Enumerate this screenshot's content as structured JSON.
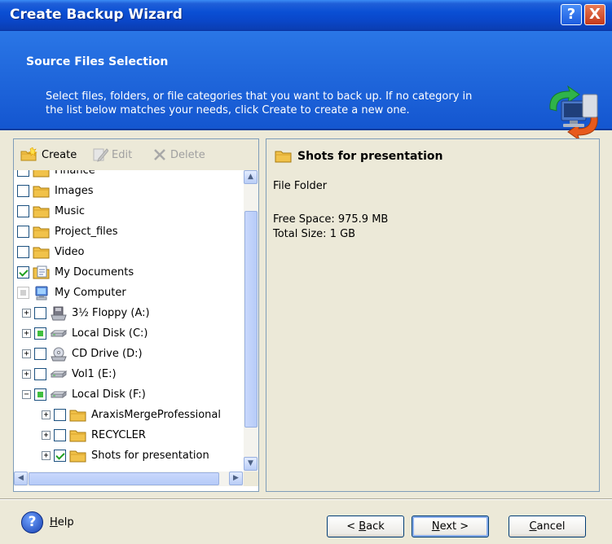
{
  "window": {
    "title": "Create Backup Wizard",
    "help_btn": "?",
    "close_btn": "X"
  },
  "header": {
    "title": "Source Files Selection",
    "description_line1": "Select files, folders, or file categories that you want to back up. If no category in",
    "description_line2": "the list below matches your needs, click Create to create a new one."
  },
  "toolbar": {
    "create": "Create",
    "edit": "Edit",
    "delete": "Delete"
  },
  "tree": [
    {
      "label": "Finance",
      "level": 0,
      "checkbox": "unchecked",
      "icon": "folder-icon",
      "expander": false
    },
    {
      "label": "Images",
      "level": 0,
      "checkbox": "unchecked",
      "icon": "folder-icon",
      "expander": false
    },
    {
      "label": "Music",
      "level": 0,
      "checkbox": "unchecked",
      "icon": "folder-icon",
      "expander": false
    },
    {
      "label": "Project_files",
      "level": 0,
      "checkbox": "unchecked",
      "icon": "folder-icon",
      "expander": false
    },
    {
      "label": "Video",
      "level": 0,
      "checkbox": "unchecked",
      "icon": "folder-icon",
      "expander": false
    },
    {
      "label": "My Documents",
      "level": 0,
      "checkbox": "checked",
      "icon": "my-documents-icon",
      "expander": false
    },
    {
      "label": "My Computer",
      "level": 0,
      "checkbox": "partial-dimmed",
      "icon": "my-computer-icon",
      "expander": false
    },
    {
      "label": "3½ Floppy (A:)",
      "level": 1,
      "checkbox": "unchecked",
      "icon": "floppy-drive-icon",
      "expander": "+"
    },
    {
      "label": "Local Disk (C:)",
      "level": 1,
      "checkbox": "partial",
      "icon": "hard-disk-icon",
      "expander": "+"
    },
    {
      "label": "CD Drive (D:)",
      "level": 1,
      "checkbox": "unchecked",
      "icon": "cd-drive-icon",
      "expander": "+"
    },
    {
      "label": "Vol1 (E:)",
      "level": 1,
      "checkbox": "unchecked",
      "icon": "hard-disk-icon",
      "expander": "+"
    },
    {
      "label": "Local Disk (F:)",
      "level": 1,
      "checkbox": "partial",
      "icon": "hard-disk-icon",
      "expander": "−"
    },
    {
      "label": "AraxisMergeProfessional",
      "level": 2,
      "checkbox": "unchecked",
      "icon": "folder-icon",
      "expander": "+"
    },
    {
      "label": "RECYCLER",
      "level": 2,
      "checkbox": "unchecked",
      "icon": "folder-icon",
      "expander": "+"
    },
    {
      "label": "Shots for presentation",
      "level": 2,
      "checkbox": "checked",
      "icon": "folder-icon",
      "expander": "+"
    }
  ],
  "details": {
    "title": "Shots for presentation",
    "type": "File Folder",
    "free_space": "Free Space: 975.9 MB",
    "total_size": "Total Size: 1 GB"
  },
  "footer": {
    "help": "Help",
    "back": "< Back",
    "next": "Next >",
    "cancel": "Cancel"
  },
  "colors": {
    "title_bar": "#0a4fd4",
    "header_band": "#1c62da",
    "dialog_bg": "#ece9d8",
    "check_green": "#21a121"
  }
}
